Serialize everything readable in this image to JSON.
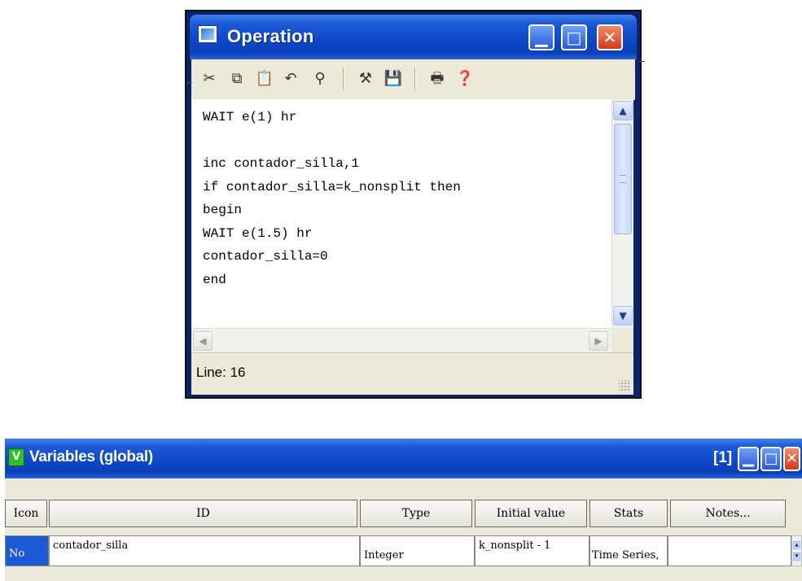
{
  "operation_window": {
    "title": "Operation",
    "code": "WAIT e(1) hr\n\ninc contador_silla,1\nif contador_silla=k_nonsplit then\nbegin\nWAIT e(1.5) hr\ncontador_silla=0\nend",
    "status": "Line: 16",
    "toolbar_icons": [
      "cut-icon",
      "copy-icon",
      "paste-icon",
      "undo-icon",
      "find-icon",
      "build-icon",
      "save-icon",
      "print-icon",
      "help-icon"
    ]
  },
  "variables_window": {
    "title": "Variables (global)",
    "count": "[1]",
    "columns": {
      "icon": "Icon",
      "id": "ID",
      "type": "Type",
      "initial_value": "Initial value",
      "stats": "Stats",
      "notes": "Notes..."
    },
    "rows": [
      {
        "icon": "No",
        "id": "contador_silla",
        "type": "Integer",
        "initial_value": "k_nonsplit - 1",
        "stats": "Time Series,",
        "notes": ""
      }
    ]
  },
  "colors": {
    "titlebar": "#0e49c8",
    "close_button": "#d23a18",
    "face": "#ece9d8"
  }
}
